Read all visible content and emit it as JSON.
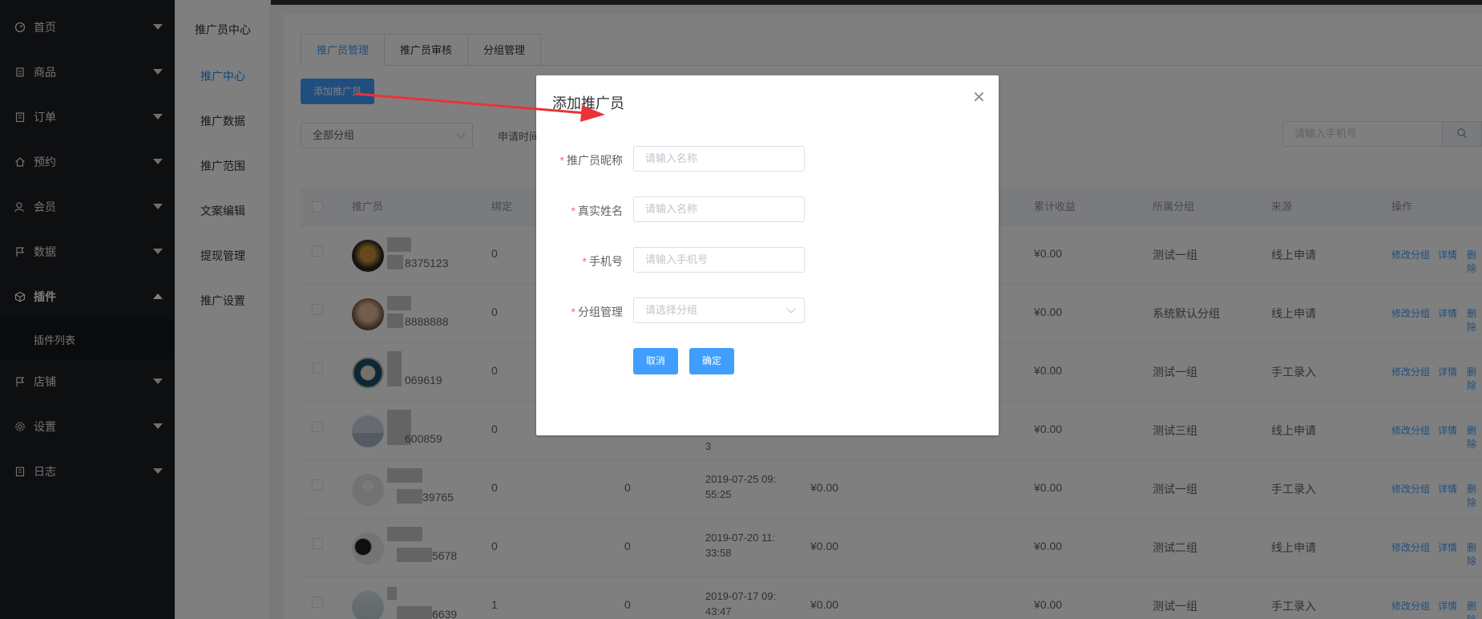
{
  "sidebar": {
    "items": [
      {
        "label": "首页",
        "icon": "dashboard-icon"
      },
      {
        "label": "商品",
        "icon": "product-icon"
      },
      {
        "label": "订单",
        "icon": "order-icon"
      },
      {
        "label": "预约",
        "icon": "home-icon"
      },
      {
        "label": "会员",
        "icon": "user-icon"
      },
      {
        "label": "数据",
        "icon": "flag-icon"
      },
      {
        "label": "插件",
        "icon": "cube-icon"
      },
      {
        "label": "店铺",
        "icon": "flag-icon"
      },
      {
        "label": "设置",
        "icon": "gear-icon"
      },
      {
        "label": "日志",
        "icon": "log-icon"
      }
    ],
    "sub_item": "插件列表"
  },
  "submenu": {
    "items": [
      "推广员中心",
      "推广中心",
      "推广数据",
      "推广范围",
      "文案编辑",
      "提现管理",
      "推广设置"
    ]
  },
  "tabs": [
    "推广员管理",
    "推广员审核",
    "分组管理"
  ],
  "toolbar": {
    "add_label": "添加推广员",
    "group_select_value": "全部分组",
    "apply_time_label": "申请时间",
    "search_placeholder": "请输入手机号"
  },
  "table": {
    "headers": [
      "推广员",
      "绑定",
      "累计收益",
      "所属分组",
      "来源",
      "操作"
    ],
    "rows": [
      {
        "phone_tail": "8375123",
        "bind": "0",
        "col3": "",
        "date": "",
        "balance": "",
        "total": "¥0.00",
        "group": "测试一组",
        "source": "线上申请"
      },
      {
        "phone_tail": "8888888",
        "bind": "0",
        "col3": "",
        "date": "",
        "balance": "",
        "total": "¥0.00",
        "group": "系统默认分组",
        "source": "线上申请"
      },
      {
        "phone_tail": "069619",
        "bind": "0",
        "col3": "",
        "date": "",
        "balance": "",
        "total": "¥0.00",
        "group": "测试一组",
        "source": "手工录入"
      },
      {
        "phone_tail": "600859",
        "bind": "0",
        "col3": "",
        "date": "3",
        "balance": "",
        "total": "¥0.00",
        "group": "测试三组",
        "source": "线上申请"
      },
      {
        "phone_tail": "39765",
        "bind": "0",
        "col3": "0",
        "date": "2019-07-25 09:55:25",
        "balance": "¥0.00",
        "total": "¥0.00",
        "group": "测试一组",
        "source": "手工录入"
      },
      {
        "phone_tail": "5678",
        "bind": "0",
        "col3": "0",
        "date": "2019-07-20 11:33:58",
        "balance": "¥0.00",
        "total": "¥0.00",
        "group": "测试二组",
        "source": "线上申请"
      },
      {
        "phone_tail": "6639",
        "bind": "1",
        "col3": "0",
        "date": "2019-07-17 09:43:47",
        "balance": "¥0.00",
        "total": "¥0.00",
        "group": "测试一组",
        "source": "手工录入"
      }
    ],
    "actions": [
      "修改分组",
      "详情",
      "删除"
    ]
  },
  "dialog": {
    "title": "添加推广员",
    "fields": [
      {
        "label": "推广员昵称",
        "placeholder": "请输入名称"
      },
      {
        "label": "真实姓名",
        "placeholder": "请输入名称"
      },
      {
        "label": "手机号",
        "placeholder": "请输入手机号"
      },
      {
        "label": "分组管理",
        "placeholder": "请选择分组"
      }
    ],
    "cancel_label": "取消",
    "confirm_label": "确定"
  },
  "colors": {
    "primary": "#409eff",
    "sidebar": "#1d1e23",
    "required": "#f56c6c",
    "annotation": "#ea3337"
  }
}
